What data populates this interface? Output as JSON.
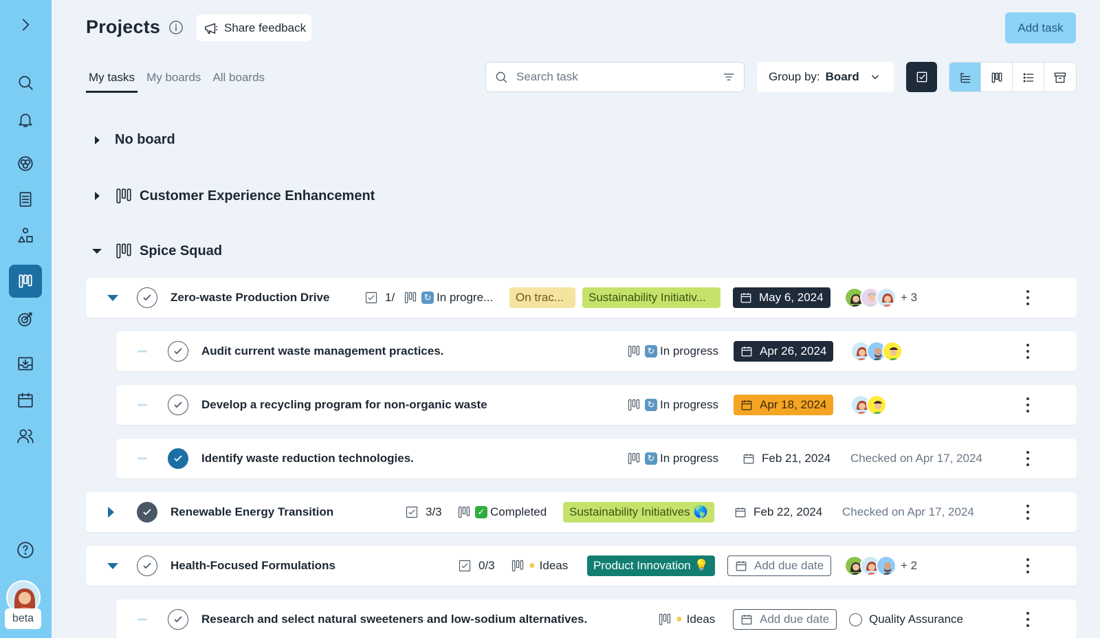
{
  "header": {
    "title": "Projects",
    "feedback_label": "Share feedback",
    "add_task_label": "Add task"
  },
  "tabs": [
    {
      "label": "My tasks",
      "active": true
    },
    {
      "label": "My boards",
      "active": false
    },
    {
      "label": "All boards",
      "active": false
    }
  ],
  "toolbar": {
    "search_placeholder": "Search task",
    "group_by_label": "Group by:",
    "group_by_value": "Board"
  },
  "sidebar": {
    "beta_label": "beta",
    "icons": [
      "expand-icon",
      "search-icon",
      "bell-icon",
      "globe-icon",
      "document-icon",
      "shapes-icon",
      "board-icon",
      "target-icon",
      "inbox-icon",
      "calendar-icon",
      "people-icon",
      "help-icon"
    ],
    "active": "board-icon"
  },
  "groups": {
    "no_board": "No board",
    "cx": "Customer Experience Enhancement",
    "spice": "Spice Squad"
  },
  "tasks": {
    "t1": {
      "name": "Zero-waste Production Drive",
      "subtasks": "1/",
      "status": "In progre...",
      "tag1": "On trac...",
      "tag2": "Sustainability Initiativ...",
      "date": "May 6, 2024",
      "more": "+ 3"
    },
    "t1a": {
      "name": "Audit current waste management practices.",
      "status": "In progress",
      "date": "Apr 26, 2024"
    },
    "t1b": {
      "name": "Develop a recycling program for non-organic waste",
      "status": "In progress",
      "date": "Apr 18, 2024"
    },
    "t1c": {
      "name": "Identify waste reduction technologies.",
      "status": "In progress",
      "date": "Feb 21, 2024",
      "checked": "Checked on Apr 17, 2024"
    },
    "t2": {
      "name": "Renewable Energy Transition",
      "subtasks": "3/3",
      "status": "Completed",
      "tag": "Sustainability Initiatives 🌎",
      "date": "Feb 22, 2024",
      "checked": "Checked on Apr 17, 2024"
    },
    "t3": {
      "name": "Health-Focused Formulations",
      "subtasks": "0/3",
      "status": "Ideas",
      "tag": "Product Innovation 💡",
      "date": "Add due date",
      "more": "+ 2"
    },
    "t3a": {
      "name": "Research and select natural sweeteners and low-sodium alternatives.",
      "status": "Ideas",
      "date": "Add due date",
      "assignee": "Quality Assurance"
    }
  },
  "colors": {
    "sidebar": "#7ccdf4",
    "accent": "#1c6fa3",
    "background": "#eef3f9"
  }
}
